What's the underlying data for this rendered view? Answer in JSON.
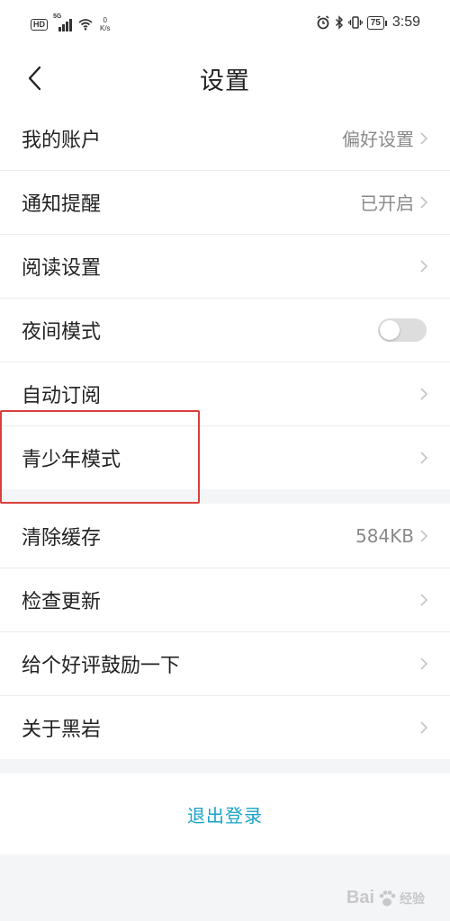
{
  "status_bar": {
    "hd_badge": "HD",
    "network": "5G",
    "net_speed_value": "0",
    "net_speed_unit": "K/s",
    "battery": "75",
    "time": "3:59"
  },
  "header": {
    "title": "设置"
  },
  "settings_group_1": [
    {
      "label": "我的账户",
      "value": "偏好设置",
      "chevron": true
    },
    {
      "label": "通知提醒",
      "value": "已开启",
      "chevron": true
    },
    {
      "label": "阅读设置",
      "value": "",
      "chevron": true
    },
    {
      "label": "夜间模式",
      "toggle": false
    },
    {
      "label": "自动订阅",
      "value": "",
      "chevron": true
    },
    {
      "label": "青少年模式",
      "value": "",
      "chevron": true
    }
  ],
  "settings_group_2": [
    {
      "label": "清除缓存",
      "value": "584KB",
      "chevron": true
    },
    {
      "label": "检查更新",
      "value": "",
      "chevron": true
    },
    {
      "label": "给个好评鼓励一下",
      "value": "",
      "chevron": true
    },
    {
      "label": "关于黑岩",
      "value": "",
      "chevron": true
    }
  ],
  "logout": {
    "label": "退出登录"
  },
  "watermark": {
    "text": "Bai",
    "sub": "经验"
  },
  "colors": {
    "accent": "#1aa3c8",
    "highlight": "#d9403a",
    "toggle_off": "#dddddd"
  }
}
